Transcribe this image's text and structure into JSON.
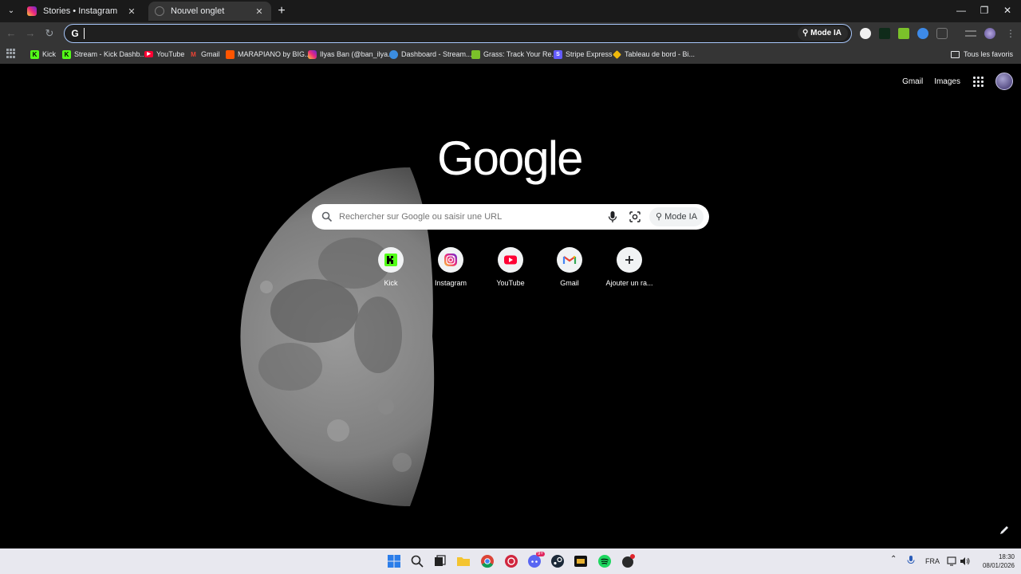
{
  "tabs": [
    {
      "title": "Stories • Instagram",
      "favicon": "instagram-icon",
      "active": false
    },
    {
      "title": "Nouvel onglet",
      "favicon": "loading-icon",
      "active": true
    }
  ],
  "omnibox": {
    "value": "",
    "mode_label": "Mode IA"
  },
  "bookmarks": [
    {
      "label": "Kick",
      "icon": "kick-icon"
    },
    {
      "label": "Stream - Kick Dashb...",
      "icon": "kick-icon"
    },
    {
      "label": "YouTube",
      "icon": "youtube-icon"
    },
    {
      "label": "Gmail",
      "icon": "gmail-icon"
    },
    {
      "label": "MARAPIANO by BIG...",
      "icon": "soundcloud-icon"
    },
    {
      "label": "Ilyas Ban (@ban_ilya...",
      "icon": "instagram-icon"
    },
    {
      "label": "Dashboard - Stream...",
      "icon": "streamlabs-icon"
    },
    {
      "label": "Grass: Track Your Re...",
      "icon": "grass-icon"
    },
    {
      "label": "Stripe Express",
      "icon": "stripe-icon"
    },
    {
      "label": "Tableau de bord - Bi...",
      "icon": "binance-icon"
    }
  ],
  "bookmarks_all": "Tous les favoris",
  "header_links": {
    "gmail": "Gmail",
    "images": "Images"
  },
  "logo": "Google",
  "search": {
    "placeholder": "Rechercher sur Google ou saisir une URL",
    "mode_label": "Mode IA"
  },
  "shortcuts": [
    {
      "label": "Kick",
      "icon": "kick-icon"
    },
    {
      "label": "Instagram",
      "icon": "instagram-icon"
    },
    {
      "label": "YouTube",
      "icon": "youtube-icon"
    },
    {
      "label": "Gmail",
      "icon": "gmail-icon"
    },
    {
      "label": "Ajouter un ra...",
      "icon": "plus-icon"
    }
  ],
  "taskbar": {
    "language": "FRA",
    "time": "18:30",
    "date": "08/01/2026",
    "discord_badge": "9+"
  },
  "colors": {
    "kick": "#53fc18",
    "youtube": "#ff0033",
    "instagram": "#e1306c",
    "omnibox_focus": "#a8c7fa",
    "chrome_dark": "#1f1f1f"
  }
}
